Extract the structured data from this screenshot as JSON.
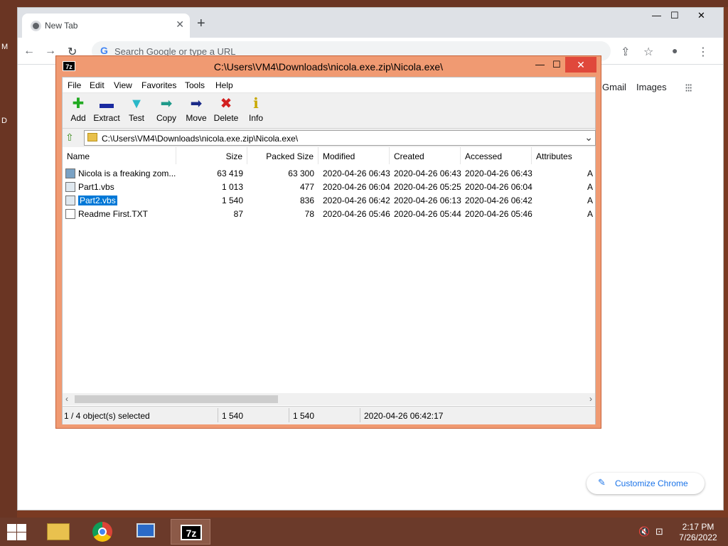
{
  "desktop": {
    "glyph_top": "M",
    "glyph_mid": "D"
  },
  "chrome": {
    "tab_title": "New Tab",
    "tab_close": "✕",
    "new_tab": "+",
    "window_controls": {
      "minimize": "—",
      "maximize": "☐",
      "close": "✕"
    },
    "nav": {
      "back": "←",
      "forward": "→",
      "reload": "↻"
    },
    "omnibox_placeholder": "Search Google or type a URL",
    "omnibox_logo": "G",
    "toolbar_icons": {
      "share": "⇪",
      "bookmark": "☆",
      "profile": "●",
      "menu": "⋮"
    },
    "links": {
      "gmail": "Gmail",
      "images": "Images"
    },
    "apps_icon": "⁝⁝⁝",
    "customize_label": "Customize Chrome",
    "customize_icon": "✎"
  },
  "zip": {
    "app_icon": "7z",
    "title": "C:\\Users\\VM4\\Downloads\\nicola.exe.zip\\Nicola.exe\\",
    "window_controls": {
      "minimize": "—",
      "maximize": "☐",
      "close": "✕"
    },
    "menu": [
      "File",
      "Edit",
      "View",
      "Favorites",
      "Tools",
      "Help"
    ],
    "toolbar": [
      {
        "label": "Add",
        "icon": "✚",
        "color": "#22aa22"
      },
      {
        "label": "Extract",
        "icon": "▬",
        "color": "#1a2aa0"
      },
      {
        "label": "Test",
        "icon": "▼",
        "color": "#2ab8c8"
      },
      {
        "label": "Copy",
        "icon": "➡",
        "color": "#1f9a8a"
      },
      {
        "label": "Move",
        "icon": "➡",
        "color": "#1a2a88"
      },
      {
        "label": "Delete",
        "icon": "✖",
        "color": "#d22020"
      },
      {
        "label": "Info",
        "icon": "ℹ",
        "color": "#c8a800"
      }
    ],
    "address": "C:\\Users\\VM4\\Downloads\\nicola.exe.zip\\Nicola.exe\\",
    "address_caret": "⌄",
    "up_icon": "⇧",
    "columns": [
      "Name",
      "Size",
      "Packed Size",
      "Modified",
      "Created",
      "Accessed",
      "Attributes"
    ],
    "rows": [
      {
        "name": "Nicola is a freaking zom...",
        "size": "63 419",
        "packed": "63 300",
        "modified": "2020-04-26 06:43",
        "created": "2020-04-26 06:43",
        "accessed": "2020-04-26 06:43",
        "attr": "A",
        "icon": "img"
      },
      {
        "name": "Part1.vbs",
        "size": "1 013",
        "packed": "477",
        "modified": "2020-04-26 06:04",
        "created": "2020-04-26 05:25",
        "accessed": "2020-04-26 06:04",
        "attr": "A",
        "icon": "vbs"
      },
      {
        "name": "Part2.vbs",
        "size": "1 540",
        "packed": "836",
        "modified": "2020-04-26 06:42",
        "created": "2020-04-26 06:13",
        "accessed": "2020-04-26 06:42",
        "attr": "A",
        "icon": "vbs",
        "selected": true
      },
      {
        "name": "Readme First.TXT",
        "size": "87",
        "packed": "78",
        "modified": "2020-04-26 05:46",
        "created": "2020-04-26 05:44",
        "accessed": "2020-04-26 05:46",
        "attr": "A",
        "icon": "txt"
      }
    ],
    "scroll_left": "‹",
    "scroll_right": "›",
    "status": {
      "selection": "1 / 4 object(s) selected",
      "size": "1 540",
      "packed": "1 540",
      "modified": "2020-04-26 06:42:17"
    }
  },
  "taskbar": {
    "apps": [
      "file-explorer",
      "chrome",
      "remote-desktop",
      "7zip"
    ],
    "zip_label": "7z",
    "tray": {
      "volume": "🔇",
      "network": "⊡"
    },
    "time": "2:17 PM",
    "date": "7/26/2022"
  }
}
